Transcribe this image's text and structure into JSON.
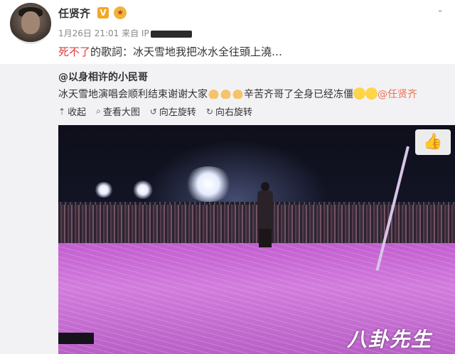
{
  "post": {
    "author": "任贤齐",
    "verified_badge": "V",
    "meta_time": "1月26日 21:01 来自 IP",
    "text_highlight": "死不了",
    "text_rest": "的歌詞：冰天雪地我把冰水全往頭上澆…"
  },
  "retweet": {
    "user": "@以身相许的小民哥",
    "text": "冰天雪地演唱会顺利结束谢谢大家",
    "text2": "辛苦齐哥了全身已经冻僵",
    "mention": "@任贤齐"
  },
  "toolbar": {
    "collapse": "收起",
    "view_large": "查看大图",
    "rotate_left": "向左旋转",
    "rotate_right": "向右旋转"
  },
  "icons": {
    "collapse": "arrow-up-icon",
    "view_large": "magnifier-icon",
    "rotate_left": "rotate-left-icon",
    "rotate_right": "rotate-right-icon",
    "like": "thumbs-up-icon"
  },
  "photo": {
    "watermark": "八卦先生"
  },
  "colors": {
    "highlight": "#e4393c",
    "mention": "#eb7350",
    "stage": "#c25ed0"
  }
}
